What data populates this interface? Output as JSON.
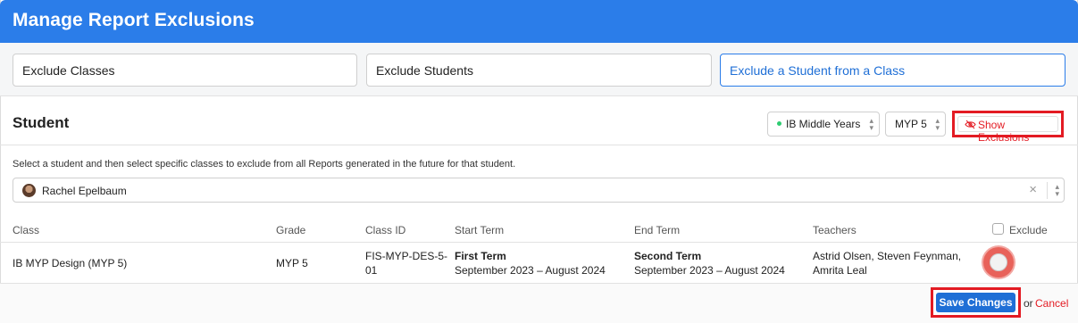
{
  "header": {
    "title": "Manage Report Exclusions"
  },
  "tabs": [
    {
      "label": "Exclude Classes"
    },
    {
      "label": "Exclude Students"
    },
    {
      "label": "Exclude a Student from a Class"
    }
  ],
  "section": {
    "title": "Student",
    "program_select": "IB Middle Years",
    "grade_select": "MYP 5",
    "show_exclusions": "Show Exclusions"
  },
  "helper_text": "Select a student and then select specific classes to exclude from all Reports generated in the future for that student.",
  "student": {
    "name": "Rachel Epelbaum"
  },
  "table": {
    "headers": [
      "Class",
      "Grade",
      "Class ID",
      "Start Term",
      "End Term",
      "Teachers",
      "Exclude"
    ],
    "rows": [
      {
        "class": "IB MYP Design (MYP 5)",
        "grade": "MYP 5",
        "class_id_1": "FIS-MYP-DES-5-",
        "class_id_2": "01",
        "start_term": "First Term",
        "start_range": "September 2023 – August 2024",
        "end_term": "Second Term",
        "end_range": "September 2023 – August 2024",
        "teachers_1": "Astrid Olsen, Steven Feynman,",
        "teachers_2": "Amrita Leal"
      }
    ]
  },
  "footer": {
    "save": "Save Changes",
    "or": "or",
    "cancel": "Cancel"
  },
  "colors": {
    "accent": "#2b7de9",
    "highlight": "#e31b23"
  }
}
